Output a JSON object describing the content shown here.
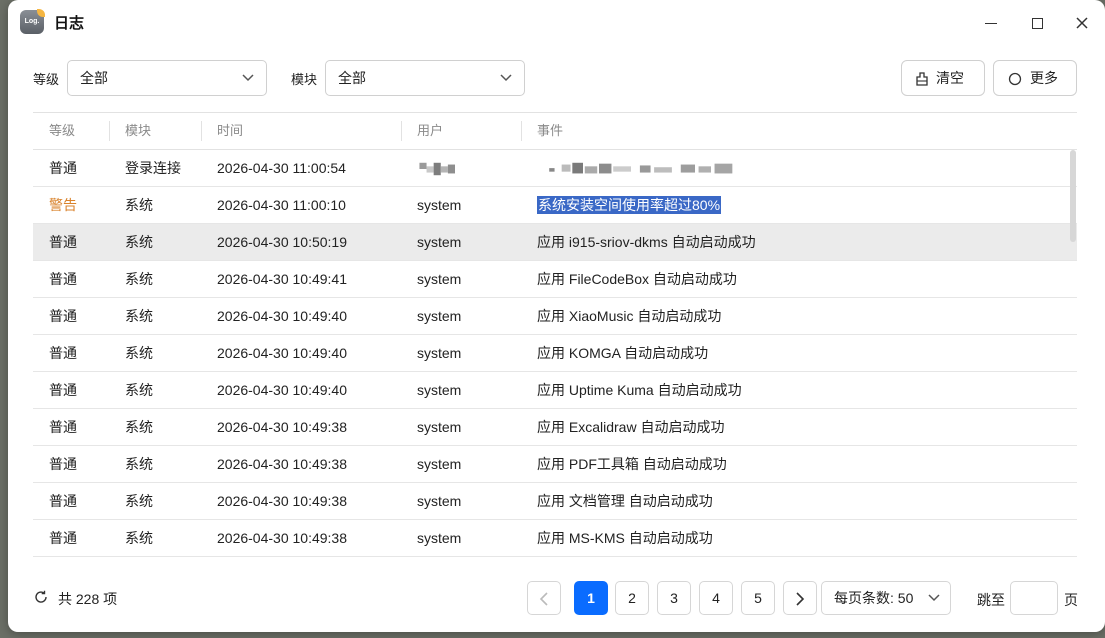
{
  "window": {
    "title": "日志",
    "app_icon_text": "Log."
  },
  "filters": {
    "level_label": "等级",
    "level_value": "全部",
    "module_label": "模块",
    "module_value": "全部"
  },
  "toolbar": {
    "clear_label": "清空",
    "more_label": "更多"
  },
  "table": {
    "columns": [
      "等级",
      "模块",
      "时间",
      "用户",
      "事件"
    ],
    "rows": [
      {
        "level": "普通",
        "module": "登录连接",
        "time": "2026-04-30 11:00:54",
        "user": "",
        "event": ""
      },
      {
        "level": "警告",
        "module": "系统",
        "time": "2026-04-30 11:00:10",
        "user": "system",
        "event": "系统安装空间使用率超过80%"
      },
      {
        "level": "普通",
        "module": "系统",
        "time": "2026-04-30 10:50:19",
        "user": "system",
        "event": "应用 i915-sriov-dkms 自动启动成功"
      },
      {
        "level": "普通",
        "module": "系统",
        "time": "2026-04-30 10:49:41",
        "user": "system",
        "event": "应用 FileCodeBox 自动启动成功"
      },
      {
        "level": "普通",
        "module": "系统",
        "time": "2026-04-30 10:49:40",
        "user": "system",
        "event": "应用 XiaoMusic 自动启动成功"
      },
      {
        "level": "普通",
        "module": "系统",
        "time": "2026-04-30 10:49:40",
        "user": "system",
        "event": "应用 KOMGA 自动启动成功"
      },
      {
        "level": "普通",
        "module": "系统",
        "time": "2026-04-30 10:49:40",
        "user": "system",
        "event": "应用 Uptime Kuma 自动启动成功"
      },
      {
        "level": "普通",
        "module": "系统",
        "time": "2026-04-30 10:49:38",
        "user": "system",
        "event": "应用 Excalidraw 自动启动成功"
      },
      {
        "level": "普通",
        "module": "系统",
        "time": "2026-04-30 10:49:38",
        "user": "system",
        "event": "应用 PDF工具箱 自动启动成功"
      },
      {
        "level": "普通",
        "module": "系统",
        "time": "2026-04-30 10:49:38",
        "user": "system",
        "event": "应用 文档管理 自动启动成功"
      },
      {
        "level": "普通",
        "module": "系统",
        "time": "2026-04-30 10:49:38",
        "user": "system",
        "event": "应用 MS-KMS 自动启动成功"
      }
    ]
  },
  "footer": {
    "total": "共 228 项",
    "pages": [
      "1",
      "2",
      "3",
      "4",
      "5"
    ],
    "current_page": "1",
    "per_page": "每页条数: 50",
    "goto_label": "跳至",
    "goto_value": "",
    "page_unit": "页"
  },
  "colors": {
    "accent": "#0a6cff",
    "warning": "#d9822b",
    "selection": "#3a68c6",
    "row_highlight": "#ebebeb"
  }
}
